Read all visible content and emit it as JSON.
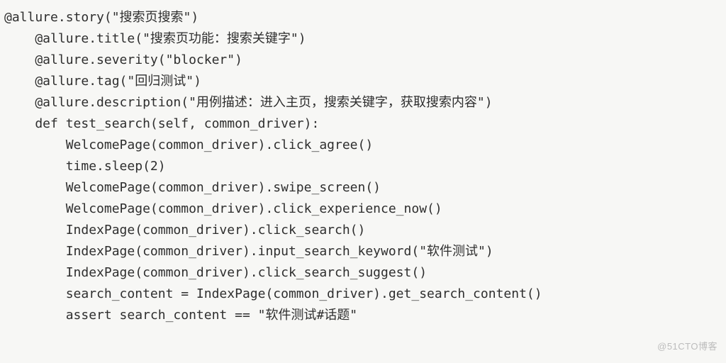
{
  "code": {
    "lines": [
      "@allure.story(\"搜索页搜索\")",
      "    @allure.title(\"搜索页功能：搜索关键字\")",
      "    @allure.severity(\"blocker\")",
      "    @allure.tag(\"回归测试\")",
      "    @allure.description(\"用例描述：进入主页，搜索关键字，获取搜索内容\")",
      "    def test_search(self, common_driver):",
      "        WelcomePage(common_driver).click_agree()",
      "        time.sleep(2)",
      "        WelcomePage(common_driver).swipe_screen()",
      "        WelcomePage(common_driver).click_experience_now()",
      "        IndexPage(common_driver).click_search()",
      "        IndexPage(common_driver).input_search_keyword(\"软件测试\")",
      "        IndexPage(common_driver).click_search_suggest()",
      "        search_content = IndexPage(common_driver).get_search_content()",
      "        assert search_content == \"软件测试#话题\""
    ]
  },
  "watermark": "@51CTO博客"
}
